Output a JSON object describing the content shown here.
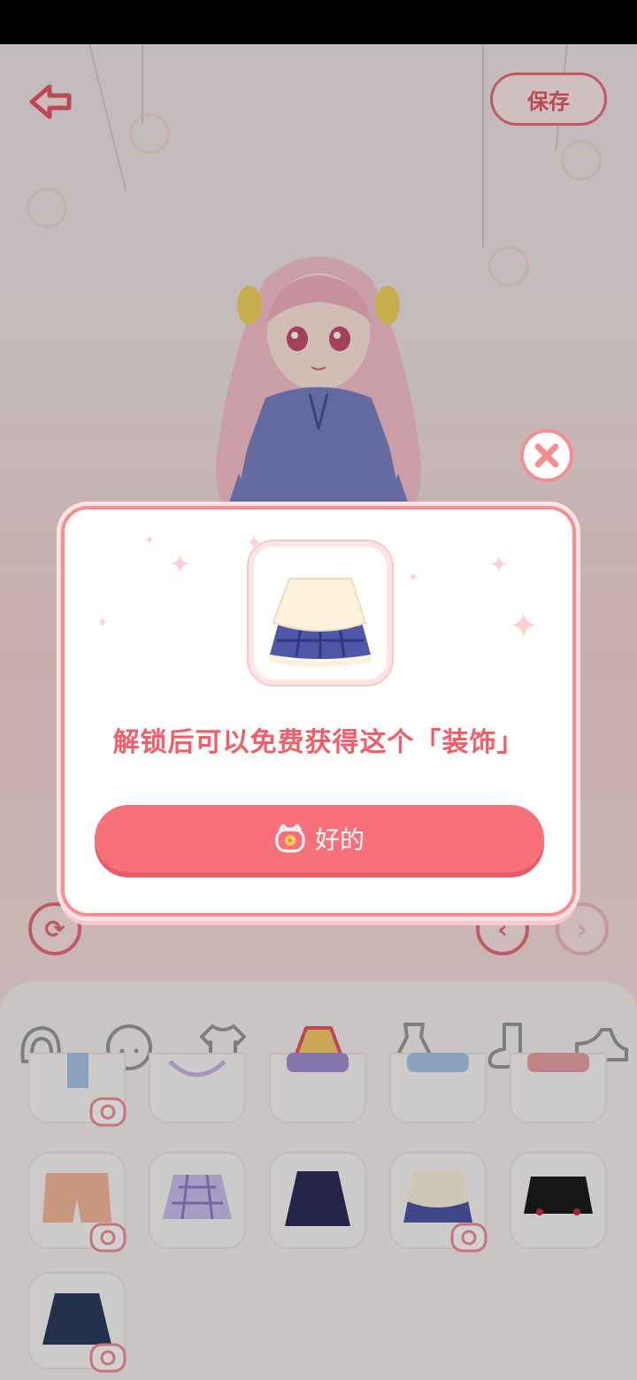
{
  "header": {
    "save_label": "保存"
  },
  "dialog": {
    "message": "解锁后可以免费获得这个「装饰」",
    "ok_label": "好的"
  },
  "categories": [
    "hair-icon",
    "face-icon",
    "top-icon",
    "skirt-icon",
    "dress-icon",
    "sock-icon",
    "shoe-icon"
  ],
  "colors": {
    "accent": "#f8707a",
    "accent_dark": "#e45a66",
    "dialog_border": "#f48e92"
  }
}
